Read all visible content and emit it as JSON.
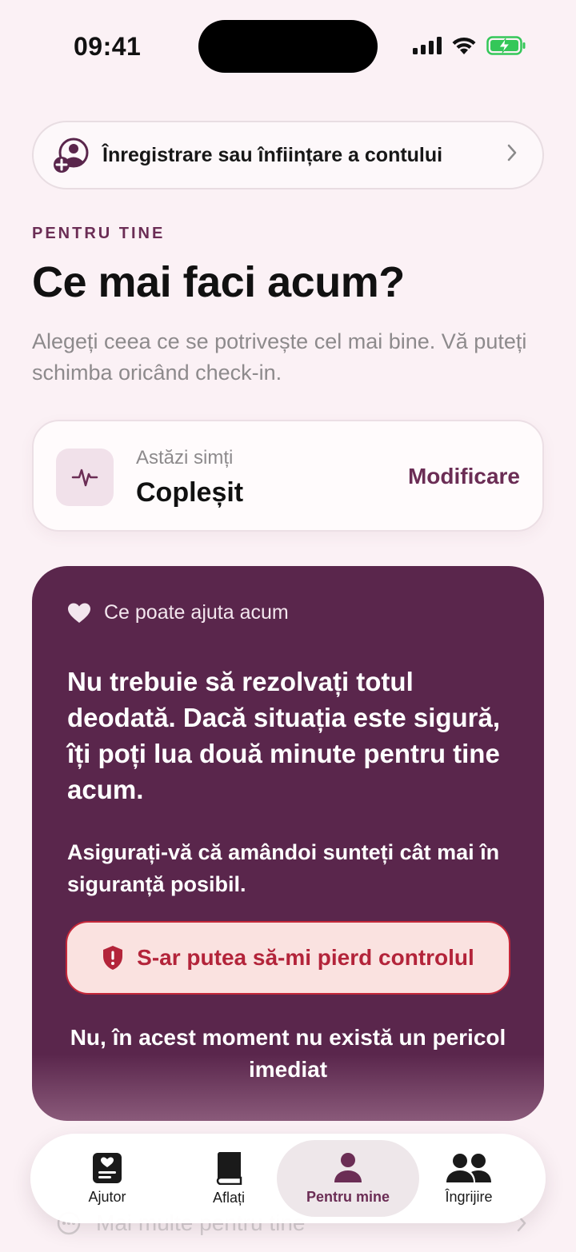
{
  "status": {
    "time": "09:41",
    "battery_color": "#34c759"
  },
  "account": {
    "label": "Înregistrare sau înființare a contului",
    "icon": "person-add-icon"
  },
  "header": {
    "eyebrow": "PENTRU TINE",
    "title": "Ce mai faci acum?",
    "subtitle": "Alegeți ceea ce se potrivește cel mai bine. Vă puteți schimba oricând check-in."
  },
  "feeling": {
    "caption": "Astăzi simți",
    "value": "Copleșit",
    "change_label": "Modificare",
    "icon": "pulse-icon"
  },
  "help": {
    "heading": "Ce poate ajuta acum",
    "main": "Nu trebuie să rezolvați totul deodată. Dacă situația este sigură, îți poți lua două minute pentru tine acum.",
    "sub": "Asigurați-vă că amândoi sunteți cât mai în siguranță posibil.",
    "danger_button": "S-ar putea să-mi pierd controlul",
    "safe_link": "Nu, în acest moment nu există un pericol imediat",
    "card_color": "#5a264c",
    "danger_color": "#b3243a"
  },
  "more": {
    "label": "Mai multe pentru tine"
  },
  "tabs": [
    {
      "label": "Ajutor",
      "icon": "heart-card-icon",
      "active": false
    },
    {
      "label": "Aflați",
      "icon": "book-icon",
      "active": false
    },
    {
      "label": "Pentru mine",
      "icon": "person-icon",
      "active": true
    },
    {
      "label": "Îngrijire",
      "icon": "people-icon",
      "active": false
    }
  ],
  "colors": {
    "accent": "#6b2d55",
    "background": "#fbf1f5"
  }
}
